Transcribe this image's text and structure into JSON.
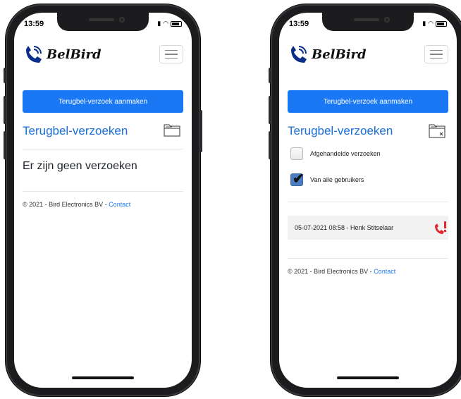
{
  "status": {
    "time": "13:59"
  },
  "brand": {
    "name": "BelBird"
  },
  "actions": {
    "create_request": "Terugbel-verzoek aanmaken"
  },
  "section": {
    "title": "Terugbel-verzoeken"
  },
  "empty_state": {
    "message": "Er zijn geen verzoeken"
  },
  "filters": [
    {
      "label": "Afgehandelde verzoeken",
      "checked": false
    },
    {
      "label": "Van alle gebruikers",
      "checked": true
    }
  ],
  "requests": [
    {
      "text": "05-07-2021 08:58 - Henk Stitselaar"
    }
  ],
  "footer": {
    "copyright": "© 2021 - Bird Electronics BV - ",
    "contact_label": "Contact"
  },
  "colors": {
    "primary": "#1a78f5",
    "title": "#1a6fd6",
    "alert": "#e3262a"
  },
  "icons": [
    "phone-logo-icon",
    "menu-icon",
    "folder-icon",
    "folder-closed-icon",
    "phone-alert-icon"
  ]
}
